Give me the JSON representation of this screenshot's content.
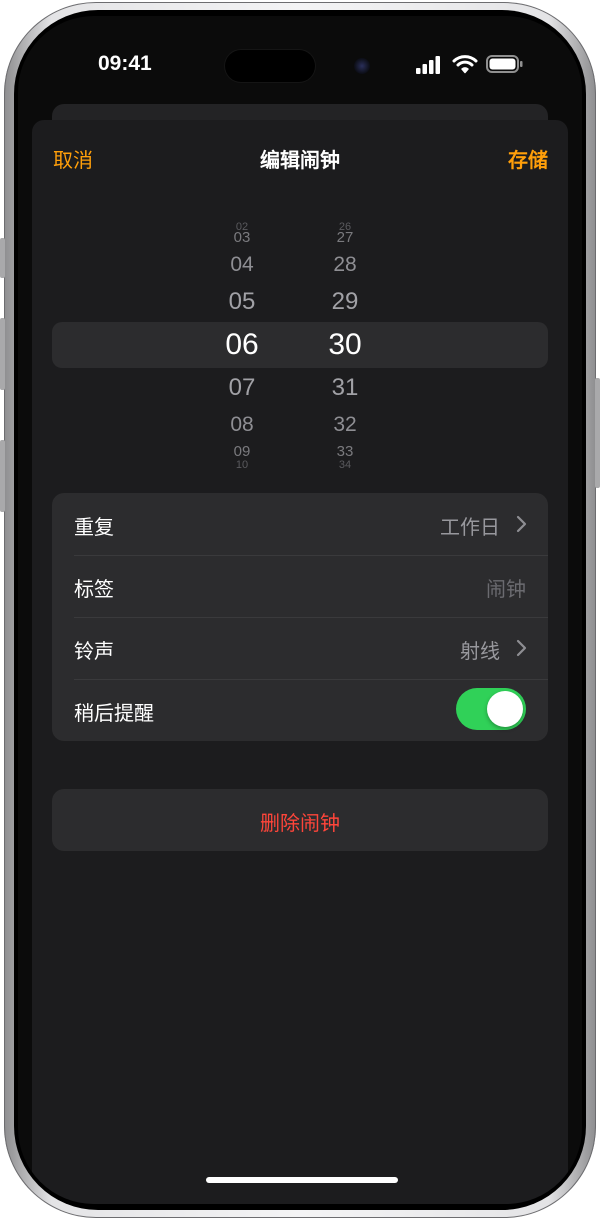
{
  "status_bar": {
    "time": "09:41"
  },
  "nav": {
    "cancel": "取消",
    "title": "编辑闹钟",
    "save": "存储"
  },
  "picker": {
    "hours": [
      "02",
      "03",
      "04",
      "05",
      "06",
      "07",
      "08",
      "09",
      "10"
    ],
    "minutes": [
      "26",
      "27",
      "28",
      "29",
      "30",
      "31",
      "32",
      "33",
      "34"
    ],
    "selected_hour": "06",
    "selected_minute": "30"
  },
  "settings": {
    "repeat": {
      "label": "重复",
      "value": "工作日"
    },
    "label": {
      "label": "标签",
      "placeholder": "闹钟"
    },
    "sound": {
      "label": "铃声",
      "value": "射线"
    },
    "snooze": {
      "label": "稍后提醒",
      "enabled": true
    }
  },
  "delete": {
    "label": "删除闹钟"
  },
  "colors": {
    "accent": "#ff9f0a",
    "destructive": "#ff453a",
    "toggle_on": "#30d158",
    "sheet_background": "#1c1c1e",
    "card_background": "#2c2c2e"
  },
  "icons": [
    "signal-icon",
    "wifi-icon",
    "battery-icon",
    "chevron-right-icon"
  ]
}
